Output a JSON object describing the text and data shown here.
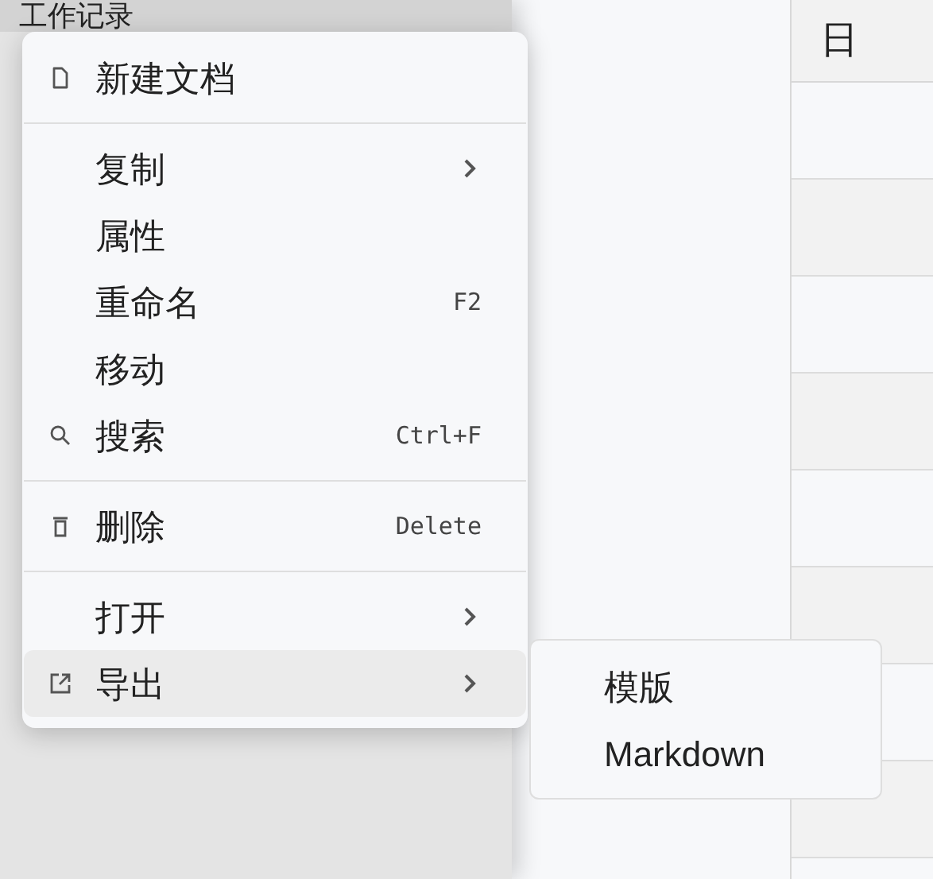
{
  "sidebar": {
    "items": [
      {
        "label": "工作记录",
        "selected": true
      }
    ]
  },
  "calendar": {
    "header": "日"
  },
  "context_menu": {
    "sections": [
      [
        {
          "label": "新建文档",
          "kind": "document",
          "selected": false
        }
      ],
      [
        {
          "label": "复制",
          "submenu": true,
          "selected": false
        },
        {
          "label": "属性",
          "selected": false
        },
        {
          "label": "重命名",
          "shortcut": "F2",
          "selected": false
        },
        {
          "label": "移动",
          "selected": false
        },
        {
          "label": "搜索",
          "kind": "search",
          "shortcut": "Ctrl+F",
          "selected": false
        }
      ],
      [
        {
          "label": "删除",
          "kind": "delete",
          "shortcut": "Delete",
          "selected": false
        }
      ],
      [
        {
          "label": "打开",
          "submenu": true,
          "selected": false
        },
        {
          "label": "导出",
          "kind": "export",
          "submenu": true,
          "selected": true
        }
      ]
    ]
  },
  "submenu": {
    "items": [
      "模版",
      "Markdown"
    ]
  }
}
